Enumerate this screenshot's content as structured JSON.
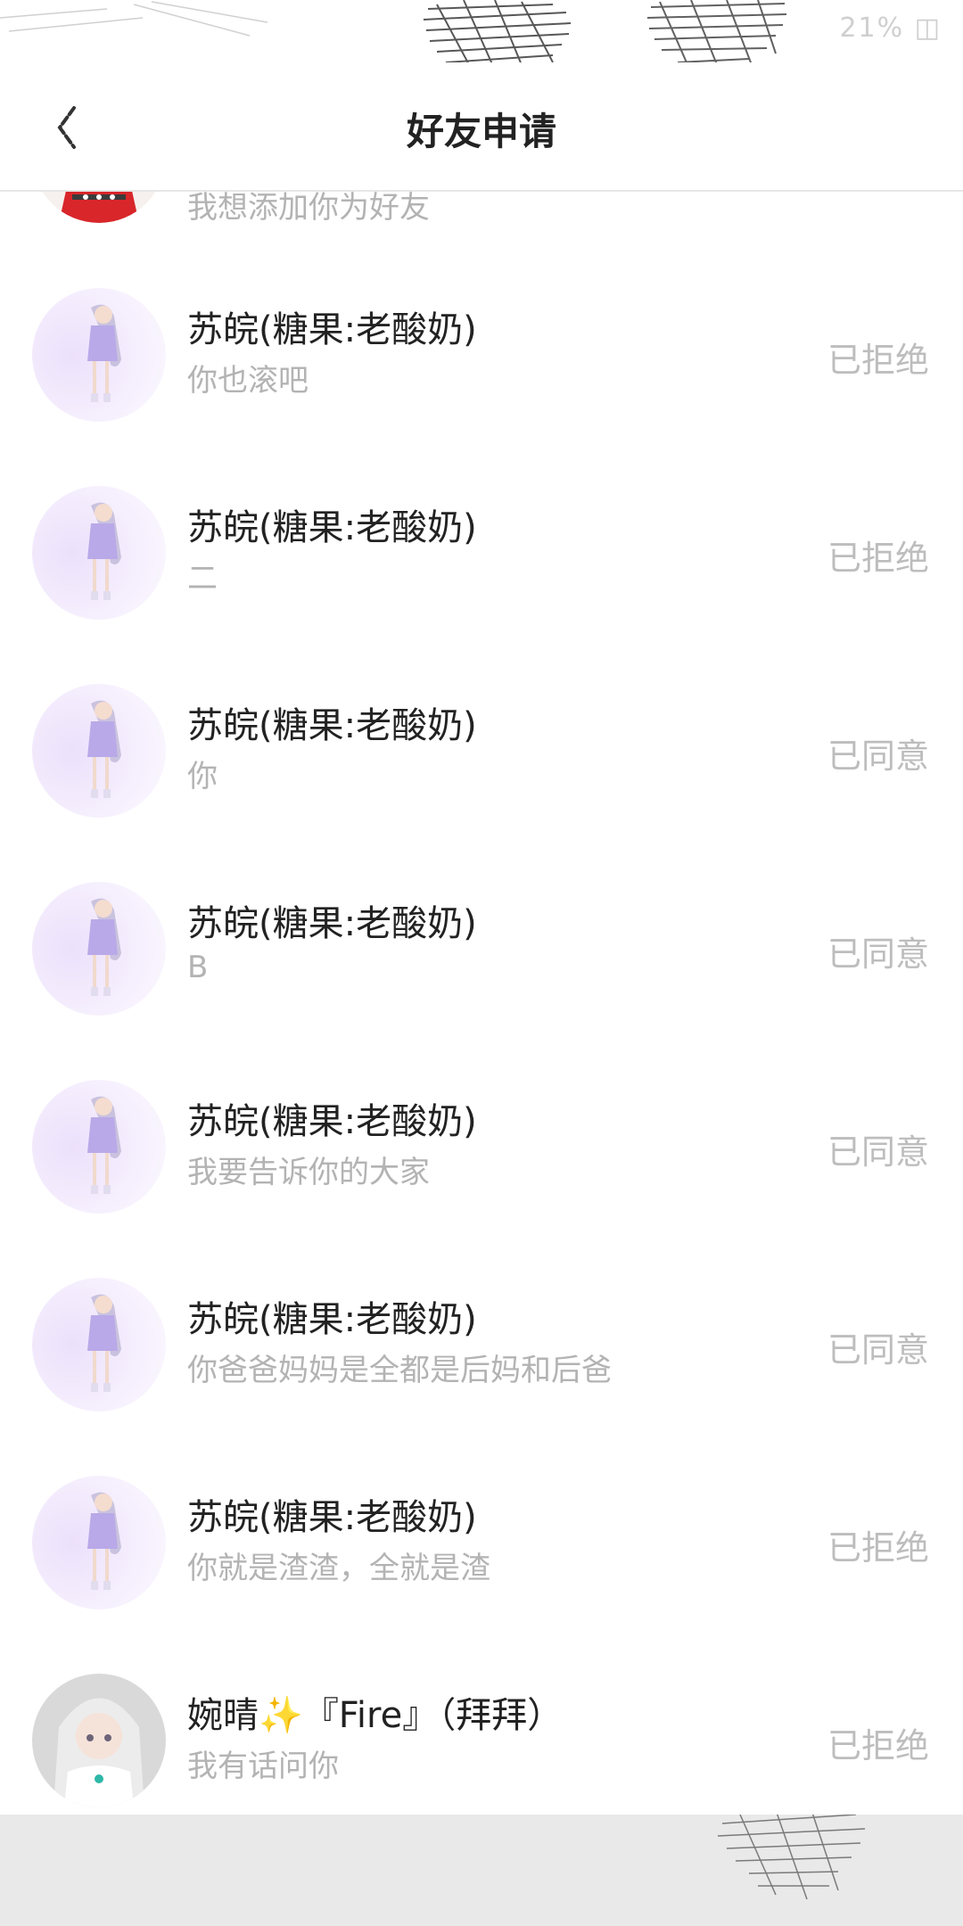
{
  "status_bar": {
    "right_text": "21% ◫"
  },
  "header": {
    "title": "好友申请"
  },
  "partial_row": {
    "message": "我想添加你为好友"
  },
  "requests": [
    {
      "name": "苏皖(糖果:老酸奶)",
      "message": "你也滚吧",
      "status": "已拒绝"
    },
    {
      "name": "苏皖(糖果:老酸奶)",
      "message": "二",
      "status": "已拒绝"
    },
    {
      "name": "苏皖(糖果:老酸奶)",
      "message": "你",
      "status": "已同意"
    },
    {
      "name": "苏皖(糖果:老酸奶)",
      "message": "B",
      "status": "已同意"
    },
    {
      "name": "苏皖(糖果:老酸奶)",
      "message": "我要告诉你的大家",
      "status": "已同意"
    },
    {
      "name": "苏皖(糖果:老酸奶)",
      "message": "你爸爸妈妈是全都是后妈和后爸",
      "status": "已同意"
    },
    {
      "name": "苏皖(糖果:老酸奶)",
      "message": "你就是渣渣，全就是渣",
      "status": "已拒绝"
    }
  ],
  "last_request": {
    "name_prefix": "婉晴",
    "sparkle": "✨",
    "name_suffix": "『Fire』（拜拜）",
    "message": "我有话问你",
    "status": "已拒绝"
  },
  "colors": {
    "title": "#222222",
    "name": "#222222",
    "message": "#b3b3b3",
    "status": "#bdbdbd",
    "divider": "#e6e6e6",
    "footer": "#e9e9e9"
  },
  "icons": {
    "back": "chevron-left-icon"
  }
}
